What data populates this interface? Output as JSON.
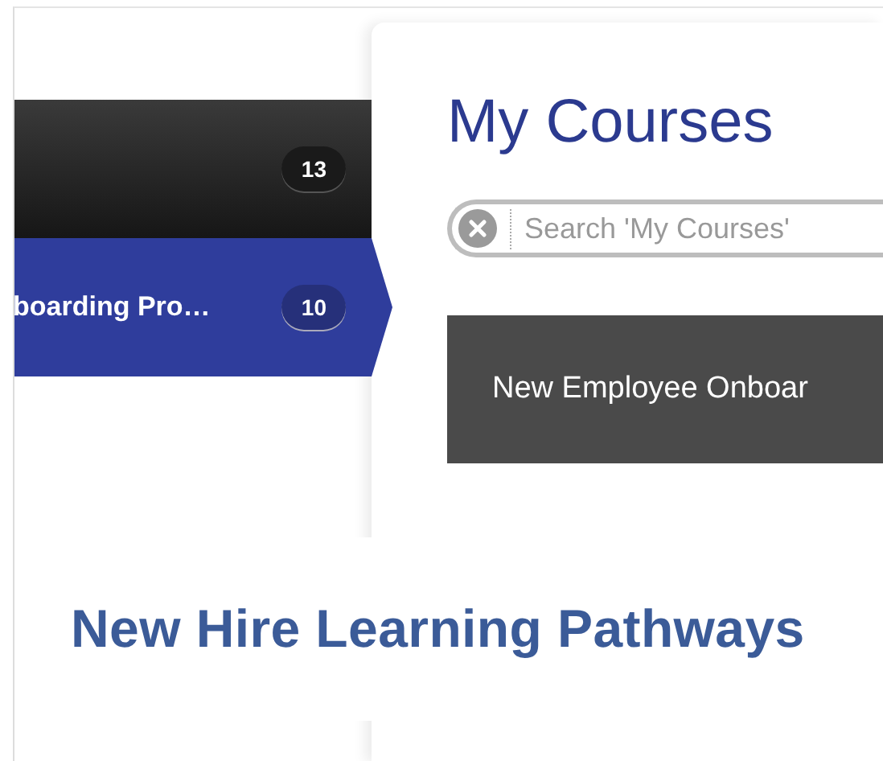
{
  "sidebar": {
    "items": [
      {
        "count": "13",
        "selected": false
      },
      {
        "label": "boarding Pro…",
        "count": "10",
        "selected": true
      }
    ]
  },
  "panel": {
    "title": "My Courses",
    "search": {
      "placeholder": "Search 'My Courses'"
    },
    "courses": [
      {
        "title": "New Employee Onboar"
      }
    ]
  },
  "banner": {
    "title": "New Hire Learning Pathways"
  }
}
